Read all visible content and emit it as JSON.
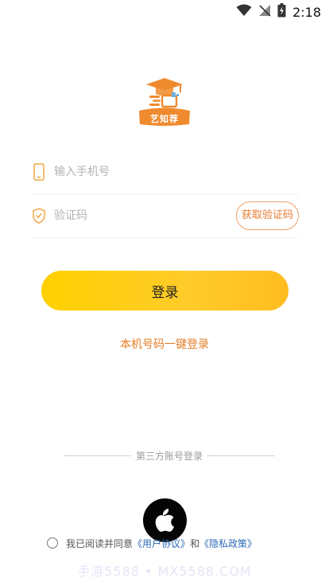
{
  "status_bar": {
    "time": "2:18",
    "icons": [
      "wifi-icon",
      "signal-no-sim-icon",
      "battery-charging-icon"
    ]
  },
  "logo": {
    "brand_text": "艺知荐",
    "icon": "graduation-cap-book-icon",
    "colors": {
      "primary": "#ef8a2e",
      "accent": "#6bb2e5"
    }
  },
  "form": {
    "phone": {
      "placeholder": "输入手机号",
      "value": "",
      "icon": "phone-icon"
    },
    "code": {
      "placeholder": "验证码",
      "value": "",
      "icon": "shield-check-icon"
    },
    "get_code_label": "获取验证码"
  },
  "login_button_label": "登录",
  "one_key_login_label": "本机号码一键登录",
  "third_party": {
    "title": "第三方账号登录",
    "apple_icon": "apple-icon"
  },
  "agreement": {
    "prefix": "我已阅读并同意",
    "user_agreement": "《用户协议》",
    "connector": "和",
    "privacy_policy": "《隐私政策》",
    "checked": false
  },
  "watermark": "手游5588 • MX5588.COM",
  "colors": {
    "brand_yellow": "#ffd000",
    "brand_orange": "#e97b2f",
    "link_blue": "#2c6bb5"
  }
}
